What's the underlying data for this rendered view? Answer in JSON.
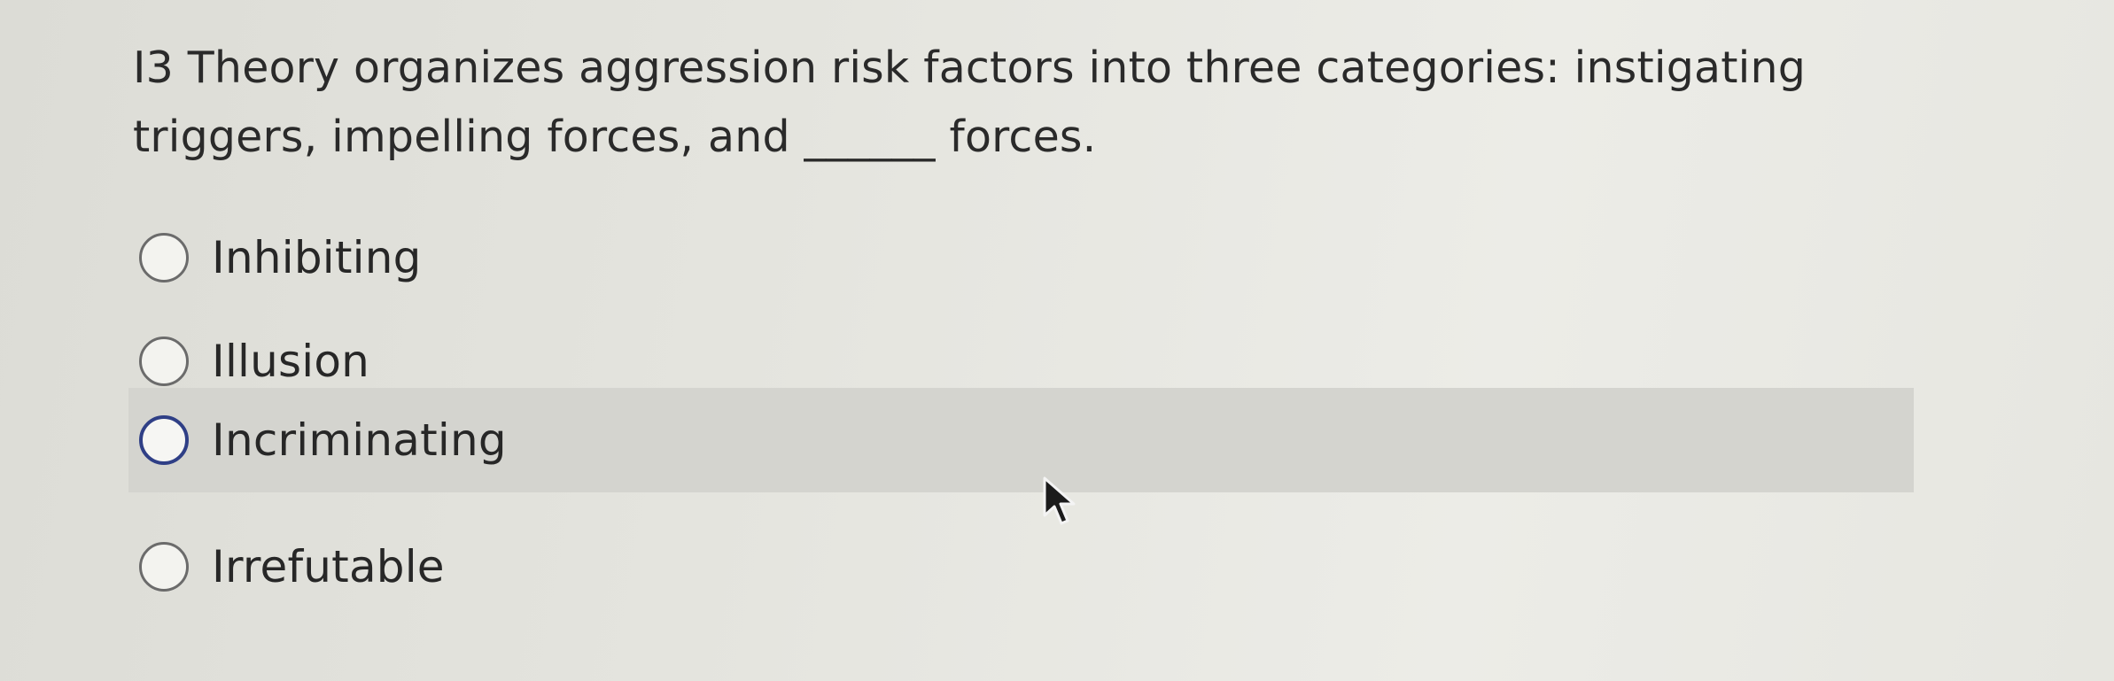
{
  "question": {
    "text": "I3 Theory organizes aggression risk factors into three categories: instigating triggers, impelling forces, and ______ forces."
  },
  "options": [
    {
      "label": "Inhibiting"
    },
    {
      "label": "Illusion"
    },
    {
      "label": "Incriminating"
    },
    {
      "label": "Irrefutable"
    }
  ],
  "icons": {
    "cursor": "mouse-pointer-arrow-icon"
  },
  "colors": {
    "hover_background": "#d4d4cf",
    "hover_radio_border": "#2f3f86"
  }
}
